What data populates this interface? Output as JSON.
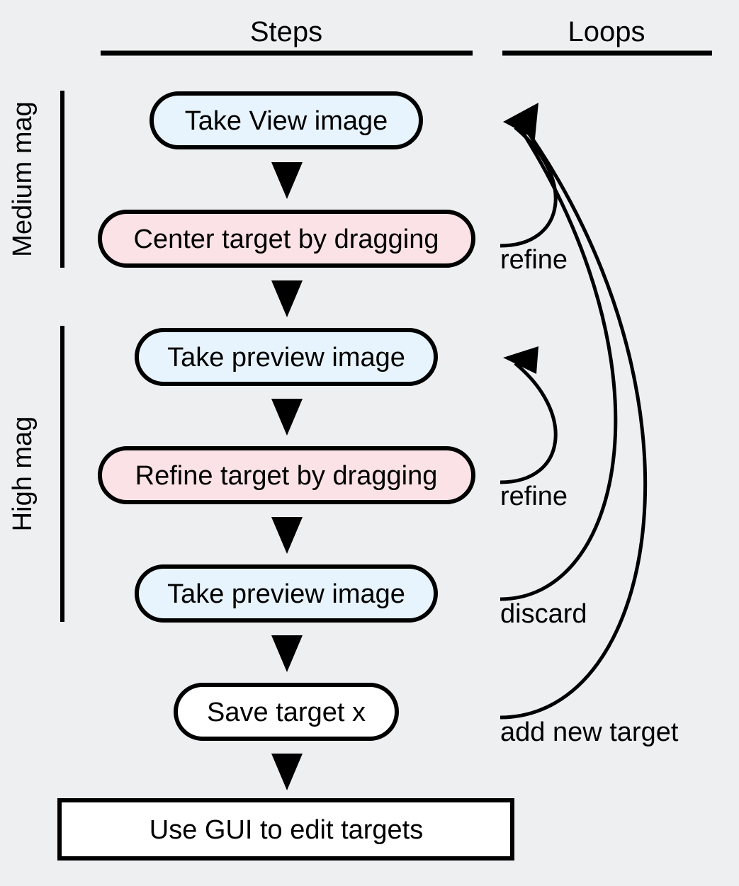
{
  "colors": {
    "background": "#eeeff1",
    "stroke": "#000000",
    "capture_fill": "#e7f4fd",
    "action_fill": "#fbe2e6",
    "plain_fill": "#ffffff"
  },
  "columns": [
    {
      "title": "Steps"
    },
    {
      "title": "Loops"
    }
  ],
  "bands": [
    {
      "label": "Medium mag"
    },
    {
      "label": "High mag"
    }
  ],
  "steps": [
    {
      "id": "take-view-image",
      "label": "Take View image",
      "kind": "capture"
    },
    {
      "id": "center-target",
      "label": "Center target by dragging",
      "kind": "action"
    },
    {
      "id": "take-preview-image-1",
      "label": "Take preview image",
      "kind": "capture"
    },
    {
      "id": "refine-target",
      "label": "Refine target by dragging",
      "kind": "action"
    },
    {
      "id": "take-preview-image-2",
      "label": "Take preview image",
      "kind": "capture"
    },
    {
      "id": "save-target",
      "label": "Save target x",
      "kind": "plain"
    },
    {
      "id": "use-gui-edit-targets",
      "label": "Use GUI to edit targets",
      "kind": "rect"
    }
  ],
  "loops": [
    {
      "id": "loop-refine-medium",
      "label": "refine",
      "from": "center-target",
      "to": "take-view-image"
    },
    {
      "id": "loop-refine-high",
      "label": "refine",
      "from": "refine-target",
      "to": "take-preview-image-1"
    },
    {
      "id": "loop-discard",
      "label": "discard",
      "from": "take-preview-image-2",
      "to": "take-view-image"
    },
    {
      "id": "loop-add-target",
      "label": "add new target",
      "from": "save-target",
      "to": "take-view-image"
    }
  ]
}
